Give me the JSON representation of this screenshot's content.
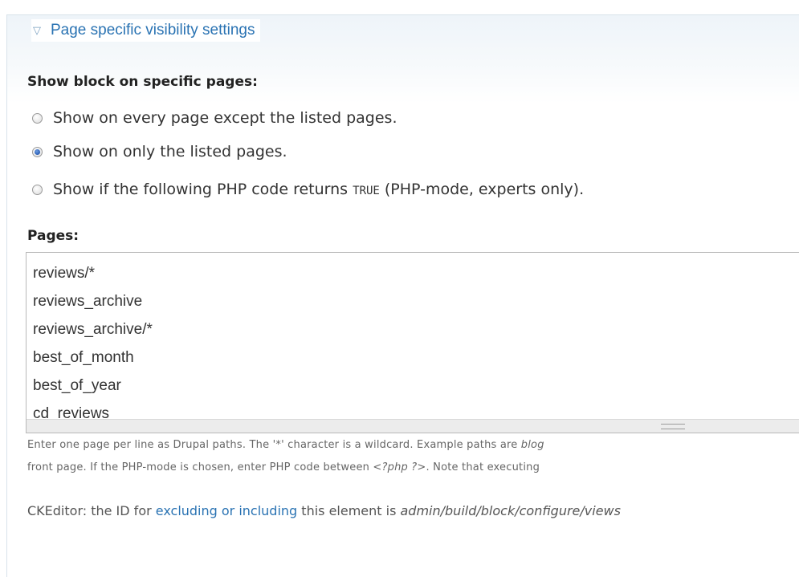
{
  "fieldset": {
    "legend_icon": "collapse-triangle-icon",
    "legend": "Page specific visibility settings"
  },
  "show_block": {
    "label": "Show block on specific pages:",
    "options": [
      {
        "label": "Show on every page except the listed pages.",
        "checked": false
      },
      {
        "label": "Show on only the listed pages.",
        "checked": true
      },
      {
        "label_before": "Show if the following PHP code returns ",
        "code": "TRUE",
        "label_after": " (PHP-mode, experts only).",
        "checked": false
      }
    ]
  },
  "pages": {
    "label": "Pages:",
    "lines": [
      "reviews/*",
      "reviews_archive",
      "reviews_archive/*",
      "best_of_month",
      "best_of_year",
      "cd_reviews"
    ]
  },
  "help": {
    "line1_text": "Enter one page per line as Drupal paths. The '*' character is a wildcard. Example paths are ",
    "line1_italic": "blog",
    "line2_text": "front page. If the PHP-mode is chosen, enter PHP code between ",
    "line2_italic": "<?php ?>",
    "line2_after": ". Note that executing"
  },
  "ckeditor": {
    "prefix": "CKEditor: the ID for ",
    "link": "excluding or including",
    "middle": " this element is ",
    "id": "admin/build/block/configure/views"
  }
}
